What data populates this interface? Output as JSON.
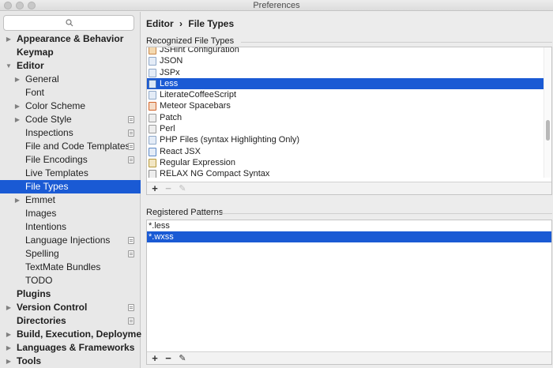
{
  "window": {
    "title": "Preferences"
  },
  "search": {
    "placeholder": ""
  },
  "sidebar": {
    "items": [
      {
        "label": "Appearance & Behavior",
        "bold": true,
        "arrow": true,
        "indent": 0,
        "copy": false
      },
      {
        "label": "Keymap",
        "bold": true,
        "arrow": false,
        "indent": 0,
        "copy": false
      },
      {
        "label": "Editor",
        "bold": true,
        "arrow": true,
        "expanded": true,
        "indent": 0,
        "copy": false
      },
      {
        "label": "General",
        "bold": false,
        "arrow": true,
        "indent": 1,
        "copy": false
      },
      {
        "label": "Font",
        "bold": false,
        "arrow": false,
        "indent": 1,
        "copy": false
      },
      {
        "label": "Color Scheme",
        "bold": false,
        "arrow": true,
        "indent": 1,
        "copy": false
      },
      {
        "label": "Code Style",
        "bold": false,
        "arrow": true,
        "indent": 1,
        "copy": true
      },
      {
        "label": "Inspections",
        "bold": false,
        "arrow": false,
        "indent": 1,
        "copy": true
      },
      {
        "label": "File and Code Templates",
        "bold": false,
        "arrow": false,
        "indent": 1,
        "copy": true
      },
      {
        "label": "File Encodings",
        "bold": false,
        "arrow": false,
        "indent": 1,
        "copy": true
      },
      {
        "label": "Live Templates",
        "bold": false,
        "arrow": false,
        "indent": 1,
        "copy": false
      },
      {
        "label": "File Types",
        "bold": false,
        "arrow": false,
        "indent": 1,
        "copy": false,
        "selected": true
      },
      {
        "label": "Emmet",
        "bold": false,
        "arrow": true,
        "indent": 1,
        "copy": false
      },
      {
        "label": "Images",
        "bold": false,
        "arrow": false,
        "indent": 1,
        "copy": false
      },
      {
        "label": "Intentions",
        "bold": false,
        "arrow": false,
        "indent": 1,
        "copy": false
      },
      {
        "label": "Language Injections",
        "bold": false,
        "arrow": false,
        "indent": 1,
        "copy": true
      },
      {
        "label": "Spelling",
        "bold": false,
        "arrow": false,
        "indent": 1,
        "copy": true
      },
      {
        "label": "TextMate Bundles",
        "bold": false,
        "arrow": false,
        "indent": 1,
        "copy": false
      },
      {
        "label": "TODO",
        "bold": false,
        "arrow": false,
        "indent": 1,
        "copy": false
      },
      {
        "label": "Plugins",
        "bold": true,
        "arrow": false,
        "indent": 0,
        "copy": false
      },
      {
        "label": "Version Control",
        "bold": true,
        "arrow": true,
        "indent": 0,
        "copy": true
      },
      {
        "label": "Directories",
        "bold": true,
        "arrow": false,
        "indent": 0,
        "copy": true
      },
      {
        "label": "Build, Execution, Deployment",
        "bold": true,
        "arrow": true,
        "indent": 0,
        "copy": false
      },
      {
        "label": "Languages & Frameworks",
        "bold": true,
        "arrow": true,
        "indent": 0,
        "copy": false
      },
      {
        "label": "Tools",
        "bold": true,
        "arrow": true,
        "indent": 0,
        "copy": false
      }
    ]
  },
  "breadcrumb": {
    "part1": "Editor",
    "separator": "›",
    "part2": "File Types"
  },
  "recognized": {
    "title": "Recognized File Types",
    "items": [
      {
        "label": "JSHint Configuration",
        "icon": "jshint-file-icon"
      },
      {
        "label": "JSON",
        "icon": "json-file-icon"
      },
      {
        "label": "JSPx",
        "icon": "jspx-file-icon"
      },
      {
        "label": "Less",
        "icon": "less-file-icon",
        "selected": true
      },
      {
        "label": "LiterateCoffeeScript",
        "icon": "coffeescript-file-icon"
      },
      {
        "label": "Meteor Spacebars",
        "icon": "meteor-file-icon"
      },
      {
        "label": "Patch",
        "icon": "patch-file-icon"
      },
      {
        "label": "Perl",
        "icon": "perl-file-icon"
      },
      {
        "label": "PHP Files (syntax Highlighting Only)",
        "icon": "php-file-icon"
      },
      {
        "label": "React JSX",
        "icon": "react-file-icon"
      },
      {
        "label": "Regular Expression",
        "icon": "regex-file-icon"
      },
      {
        "label": "RELAX NG Compact Syntax",
        "icon": "relaxng-file-icon"
      }
    ]
  },
  "patterns": {
    "title": "Registered Patterns",
    "items": [
      {
        "label": "*.less"
      },
      {
        "label": "*.wxss",
        "selected": true
      }
    ]
  },
  "toolbar": {
    "add": "+",
    "remove": "−",
    "edit": "✎"
  },
  "colors": {
    "selection": "#1a5ad4",
    "sidebar": "#e8e8e8"
  }
}
